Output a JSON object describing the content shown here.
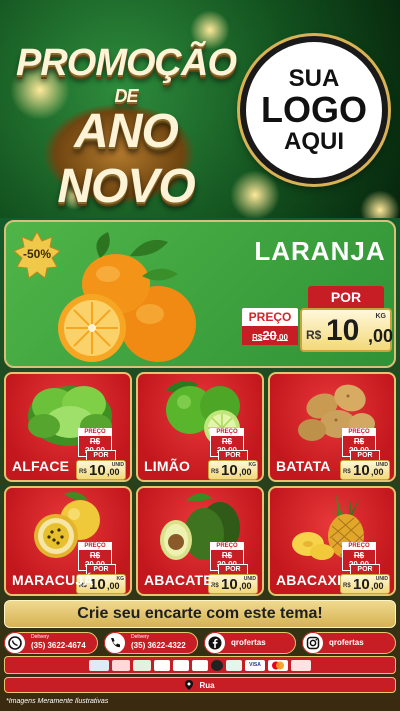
{
  "header": {
    "title_line1": "PROMOÇÃO",
    "title_line2": "DE",
    "title_line3": "ANO NOVO",
    "logo_line1": "SUA",
    "logo_line2": "LOGO",
    "logo_line3": "AQUI"
  },
  "featured": {
    "discount": "-50%",
    "name": "LARANJA",
    "old_label": "PREÇO",
    "old_currency": "R$",
    "old_value": "20",
    "old_cents": ",00",
    "new_label": "POR",
    "new_currency": "R$",
    "new_value": "10",
    "new_cents": ",00",
    "unit": "KG"
  },
  "products": [
    {
      "name": "ALFACE",
      "old_label": "PREÇO",
      "old_price": "R$ 20,00",
      "new_label": "POR",
      "currency": "R$",
      "value": "10",
      "cents": ",00",
      "unit": "UNID"
    },
    {
      "name": "LIMÃO",
      "old_label": "PREÇO",
      "old_price": "R$ 20,00",
      "new_label": "POR",
      "currency": "R$",
      "value": "10",
      "cents": ",00",
      "unit": "KG"
    },
    {
      "name": "BATATA",
      "old_label": "PREÇO",
      "old_price": "R$ 20,00",
      "new_label": "POR",
      "currency": "R$",
      "value": "10",
      "cents": ",00",
      "unit": "UNID"
    },
    {
      "name": "MARACUJÁ",
      "old_label": "PREÇO",
      "old_price": "R$ 20,00",
      "new_label": "POR",
      "currency": "R$",
      "value": "10",
      "cents": ",00",
      "unit": "KG"
    },
    {
      "name": "ABACATE",
      "old_label": "PREÇO",
      "old_price": "R$ 20,00",
      "new_label": "POR",
      "currency": "R$",
      "value": "10",
      "cents": ",00",
      "unit": "UNID"
    },
    {
      "name": "ABACAXI",
      "old_label": "PREÇO",
      "old_price": "R$ 20,00",
      "new_label": "POR",
      "currency": "R$",
      "value": "10",
      "cents": ",00",
      "unit": "UNID"
    }
  ],
  "cta": "Crie seu encarte com este tema!",
  "contacts": [
    {
      "caption": "Delivery",
      "text": "(35) 3622-4674",
      "icon": "whatsapp-icon"
    },
    {
      "caption": "Delivery",
      "text": "(35) 3622-4322",
      "icon": "phone-icon"
    },
    {
      "text": "qrofertas",
      "icon": "facebook-icon"
    },
    {
      "text": "qrofertas",
      "icon": "instagram-icon"
    }
  ],
  "payments": [
    "",
    "",
    "",
    "",
    "",
    "",
    "",
    "VISA",
    ""
  ],
  "address": "Rua",
  "disclaimer": "*Imagens Meramente Ilustrativas",
  "colors": {
    "red": "#c71e25",
    "green": "#2f9236",
    "gold": "#d9b255"
  }
}
